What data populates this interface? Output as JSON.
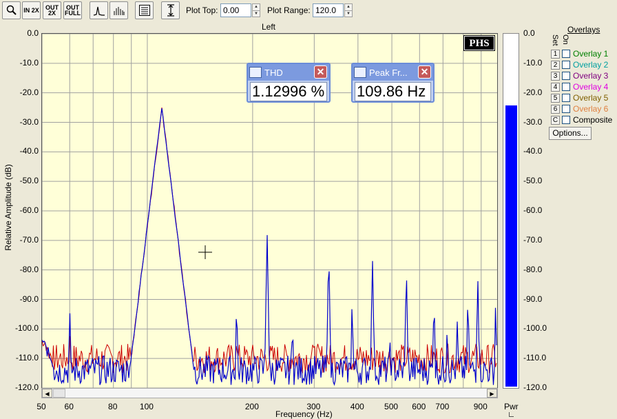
{
  "toolbar": {
    "buttons": [
      {
        "icon": "magnifier-icon",
        "text": ""
      },
      {
        "icon": "zoom-in-2x-icon",
        "text": "IN 2X"
      },
      {
        "icon": "zoom-out-2x-icon",
        "text": "OUT 2X"
      },
      {
        "icon": "zoom-out-full-icon",
        "text": "OUT FULL"
      },
      {
        "icon": "line-spectrum-icon",
        "text": ""
      },
      {
        "icon": "bar-spectrum-icon",
        "text": ""
      },
      {
        "icon": "display-options-icon",
        "text": ""
      },
      {
        "icon": "autoscale-icon",
        "text": ""
      }
    ],
    "plot_top_label": "Plot Top:",
    "plot_top_value": "0.00",
    "plot_range_label": "Plot Range:",
    "plot_range_value": "120.0"
  },
  "channel_title": "Left",
  "logo_text": "PHS",
  "readouts": [
    {
      "title": "THD",
      "value": "1.12996 %"
    },
    {
      "title": "Peak Fr...",
      "value": "109.86 Hz"
    }
  ],
  "overlays": {
    "title": "Overlays",
    "set_header": "Set",
    "on_header": "On",
    "items": [
      {
        "set": "1",
        "label": "Overlay 1",
        "color": "#008000"
      },
      {
        "set": "2",
        "label": "Overlay 2",
        "color": "#00a0a0"
      },
      {
        "set": "3",
        "label": "Overlay 3",
        "color": "#800080"
      },
      {
        "set": "4",
        "label": "Overlay 4",
        "color": "#e000e0"
      },
      {
        "set": "5",
        "label": "Overlay 5",
        "color": "#806000"
      },
      {
        "set": "6",
        "label": "Overlay 6",
        "color": "#e08040"
      },
      {
        "set": "C",
        "label": "Composite",
        "color": "#000000"
      }
    ],
    "options_label": "Options..."
  },
  "meter": {
    "label": "Pwr",
    "level_db": -24,
    "color": "#0000ff"
  },
  "chart_data": {
    "type": "line",
    "xlabel": "Frequency (Hz)",
    "ylabel": "Relative Amplitude (dB)",
    "x_scale": "log",
    "xlim": [
      50,
      1000
    ],
    "ylim": [
      -120,
      0
    ],
    "x_ticks": [
      "50",
      "60",
      "80",
      "100",
      "200",
      "300",
      "400",
      "500",
      "600",
      "700",
      "900"
    ],
    "x_tick_values": [
      50,
      60,
      80,
      100,
      200,
      300,
      400,
      500,
      600,
      700,
      900
    ],
    "y_ticks": [
      "0.0",
      "-10.0",
      "-20.0",
      "-30.0",
      "-40.0",
      "-50.0",
      "-60.0",
      "-70.0",
      "-80.0",
      "-90.0",
      "-100.0",
      "-110.0",
      "-120.0"
    ],
    "grid": true,
    "series": [
      {
        "color": "#0000cc",
        "peaks": [
          {
            "x": 60,
            "y": -91
          },
          {
            "x": 110,
            "y": -25
          },
          {
            "x": 130,
            "y": -93
          },
          {
            "x": 180,
            "y": -88
          },
          {
            "x": 220,
            "y": -67
          },
          {
            "x": 260,
            "y": -94
          },
          {
            "x": 330,
            "y": -72
          },
          {
            "x": 385,
            "y": -88
          },
          {
            "x": 440,
            "y": -75
          },
          {
            "x": 495,
            "y": -100
          },
          {
            "x": 550,
            "y": -78
          },
          {
            "x": 660,
            "y": -87
          },
          {
            "x": 720,
            "y": -95
          },
          {
            "x": 770,
            "y": -93
          },
          {
            "x": 825,
            "y": -86
          },
          {
            "x": 880,
            "y": -81
          },
          {
            "x": 990,
            "y": -89
          }
        ],
        "floor": -114
      },
      {
        "color": "#cc0000",
        "floor": -110
      }
    ]
  }
}
